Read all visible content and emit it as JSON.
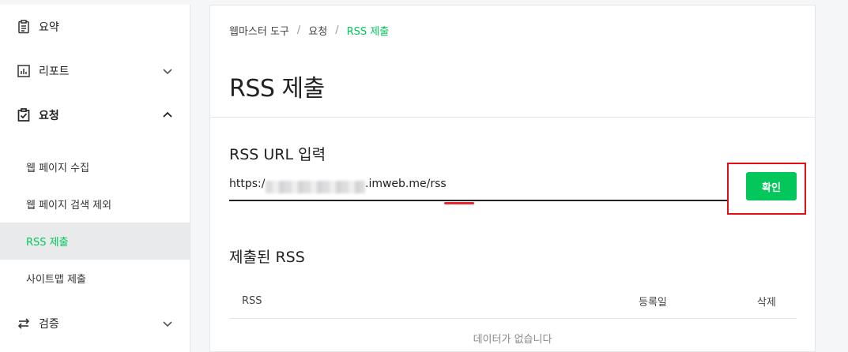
{
  "sidebar": {
    "items": [
      {
        "label": "요약",
        "icon": "clipboard-icon"
      },
      {
        "label": "리포트",
        "icon": "bar-chart-icon"
      },
      {
        "label": "요청",
        "icon": "checklist-icon"
      },
      {
        "label": "검증",
        "icon": "swap-arrows-icon"
      }
    ],
    "sub_items": [
      {
        "label": "웹 페이지 수집"
      },
      {
        "label": "웹 페이지 검색 제외"
      },
      {
        "label": "RSS 제출"
      },
      {
        "label": "사이트맵 제출"
      }
    ],
    "active_sub_item": "RSS 제출",
    "accent_color": "#03c75a"
  },
  "breadcrumb": {
    "items": [
      "웹마스터 도구",
      "요청",
      "RSS 제출"
    ]
  },
  "page": {
    "title": "RSS 제출"
  },
  "rss_input": {
    "section_title": "RSS URL 입력",
    "value_prefix": "https:/",
    "value_suffix": ".imweb.me/rss",
    "confirm_label": "확인"
  },
  "submitted": {
    "section_title": "제출된 RSS",
    "columns": [
      "RSS",
      "등록일",
      "삭제"
    ],
    "empty_text": "데이터가 없습니다"
  },
  "colors": {
    "brand_green": "#03c75a",
    "annotation_red": "#e50d15"
  }
}
